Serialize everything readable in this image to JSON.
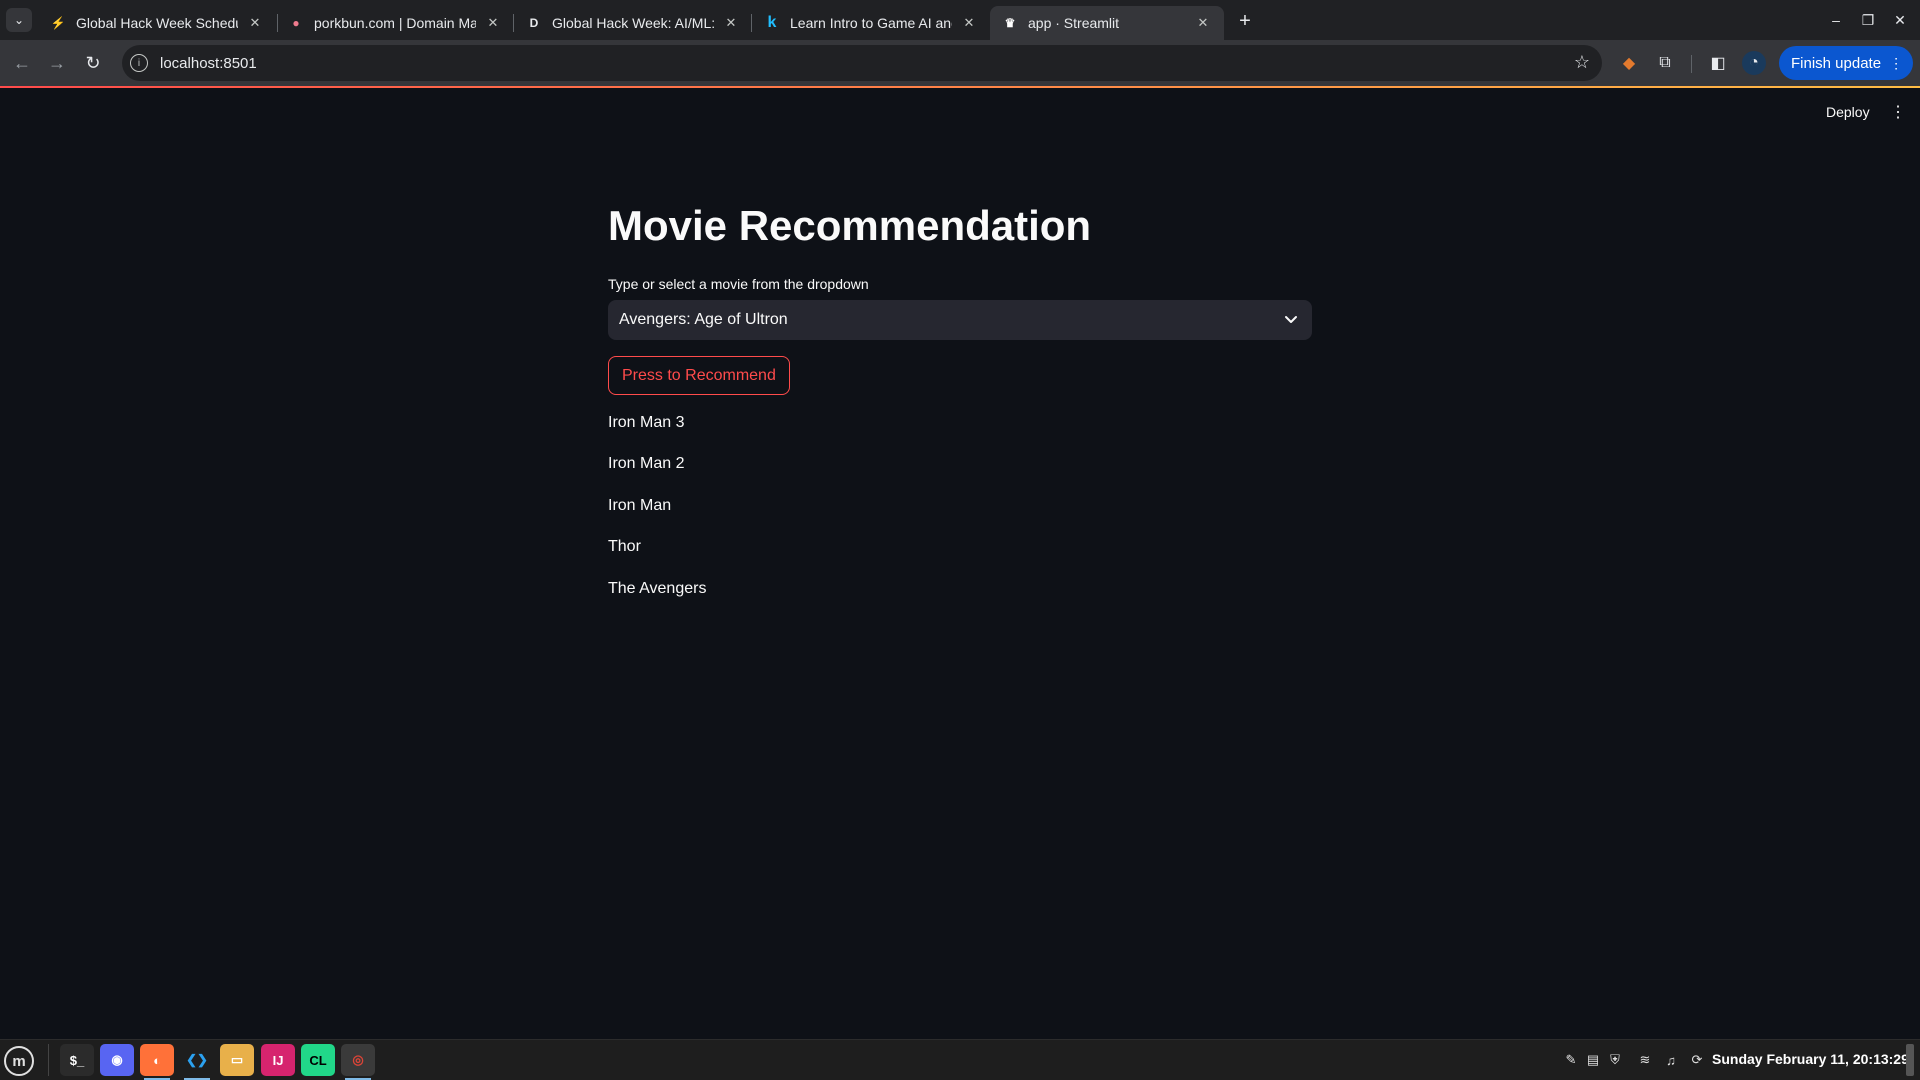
{
  "browser": {
    "tabs": [
      {
        "title": "Global Hack Week Schedule",
        "favicon": "bolt-icon",
        "favicon_color": "#f4c542",
        "active": false
      },
      {
        "title": "porkbun.com | Domain Mana",
        "favicon": "pig-icon",
        "favicon_color": "#ef7b8e",
        "active": false
      },
      {
        "title": "Global Hack Week: AI/ML: Sp",
        "favicon": "d-logo-icon",
        "favicon_color": "#e8eaed",
        "active": false
      },
      {
        "title": "Learn Intro to Game AI and R",
        "favicon": "k-logo-icon",
        "favicon_color": "#20beff",
        "active": false
      },
      {
        "title": "app · Streamlit",
        "favicon": "streamlit-crown-icon",
        "favicon_color": "#ffffff",
        "active": true
      }
    ],
    "tab_favicon_glyphs": [
      "⚡",
      "●",
      "D",
      "k",
      "♛"
    ],
    "url": "localhost:8501",
    "finish_update_label": "Finish update"
  },
  "streamlit": {
    "deploy_label": "Deploy",
    "title": "Movie Recommendation",
    "select_label": "Type or select a movie from the dropdown",
    "selected_movie": "Avengers: Age of Ultron",
    "button_label": "Press to Recommend",
    "recommendations": [
      "Iron Man 3",
      "Iron Man 2",
      "Iron Man",
      "Thor",
      "The Avengers"
    ],
    "accent_color": "#ff4b4b",
    "background_color": "#0e1117"
  },
  "taskbar": {
    "apps": [
      {
        "name": "terminal-icon",
        "glyph": "$_",
        "bg": "#2b2b2b"
      },
      {
        "name": "discord-icon",
        "glyph": "◉",
        "bg": "#5865f2"
      },
      {
        "name": "firefox-icon",
        "glyph": "◐",
        "bg": "#ff7139"
      },
      {
        "name": "vscode-icon",
        "glyph": "❮❯",
        "bg": "#1e1e1e"
      },
      {
        "name": "files-icon",
        "glyph": "▭",
        "bg": "#e8b04a"
      },
      {
        "name": "intellij-icon",
        "glyph": "IJ",
        "bg": "#d6246e"
      },
      {
        "name": "clion-icon",
        "glyph": "CL",
        "bg": "#21d789"
      },
      {
        "name": "chrome-icon",
        "glyph": "◎",
        "bg": "#db4437"
      }
    ],
    "clock": "Sunday February 11, 20:13:29"
  }
}
